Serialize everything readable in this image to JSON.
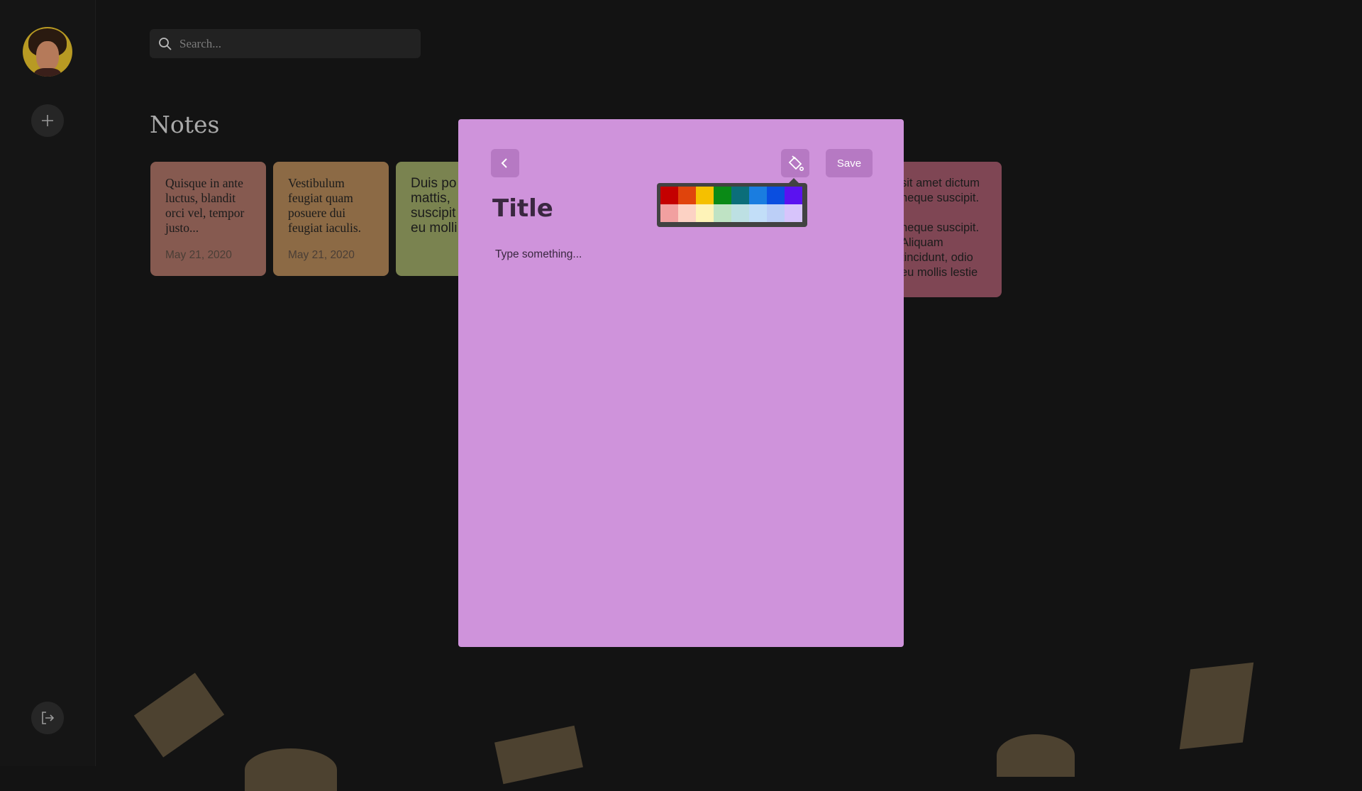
{
  "search": {
    "placeholder": "Search..."
  },
  "notes_heading": "Notes",
  "cards": [
    {
      "text": "Quisque in ante luctus, blandit orci vel, tempor justo...",
      "date": "May 21, 2020"
    },
    {
      "text": "Vestibulum feugiat quam posuere dui feugiat iaculis.",
      "date": "May 21, 2020"
    },
    {
      "text": "Duis po mattis, suscipit eu molli",
      "date": ""
    },
    {
      "text": "sit amet dictum neque suscipit.\n\nneque suscipit. Aliquam tincidunt, odio eu mollis lestie",
      "date": ""
    }
  ],
  "modal": {
    "title": "Title",
    "body_placeholder": "Type something...",
    "save_label": "Save",
    "background": "#cf93db"
  },
  "palette": {
    "row1": [
      "#c40000",
      "#e0440c",
      "#f5c000",
      "#0a8a16",
      "#0b6e7a",
      "#1a7de0",
      "#0a4ee0",
      "#5b12f0"
    ],
    "row2": [
      "#f1a0a0",
      "#fcd2c4",
      "#fef3b8",
      "#bfe3c4",
      "#bde0e3",
      "#c2def8",
      "#bccff7",
      "#d7c4fb"
    ]
  },
  "icons": {
    "add": "plus-icon",
    "logout": "logout-icon",
    "search": "search-icon",
    "back": "chevron-left-icon",
    "paint": "paint-bucket-icon"
  }
}
